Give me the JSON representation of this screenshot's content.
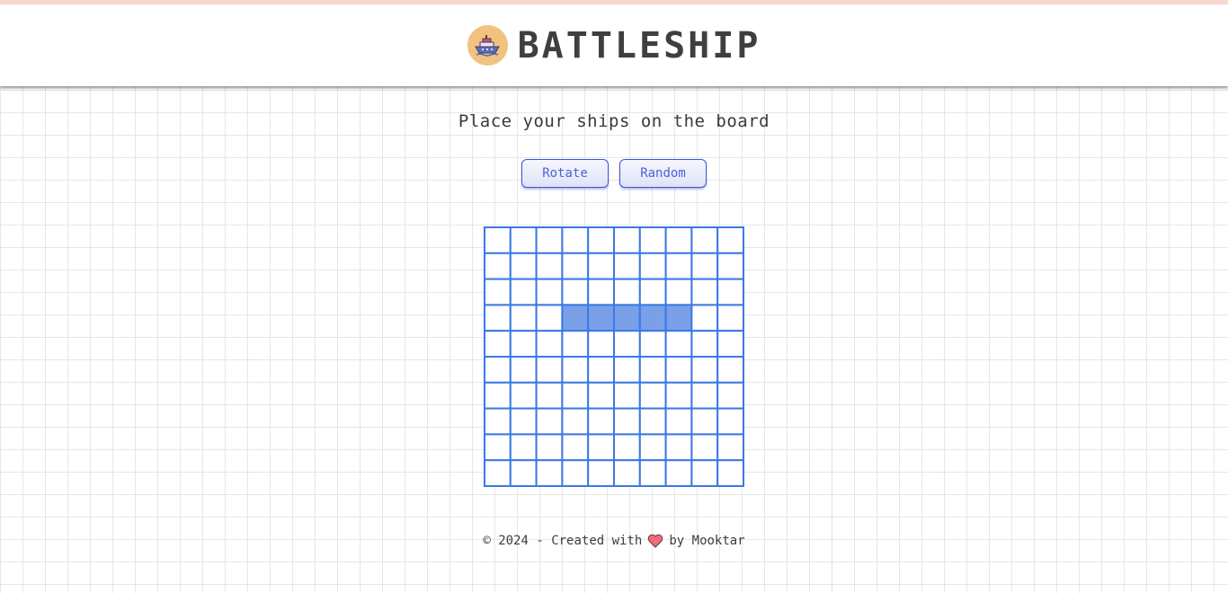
{
  "header": {
    "title": "BATTLESHIP",
    "logo_icon": "battleship-logo-icon",
    "logo_bg": "#f2c27f"
  },
  "subtitle": "Place your ships on the board",
  "controls": {
    "rotate_label": "Rotate",
    "random_label": "Random"
  },
  "board": {
    "rows": 10,
    "cols": 10,
    "grid_color": "#3b78e7",
    "ship_color": "#7aa0e8",
    "ship_cells": [
      [
        3,
        3
      ],
      [
        3,
        4
      ],
      [
        3,
        5
      ],
      [
        3,
        6
      ],
      [
        3,
        7
      ]
    ]
  },
  "footer": {
    "prefix": "© 2024 - Created with",
    "heart_icon": "heart-icon",
    "suffix": "by Mooktar"
  }
}
